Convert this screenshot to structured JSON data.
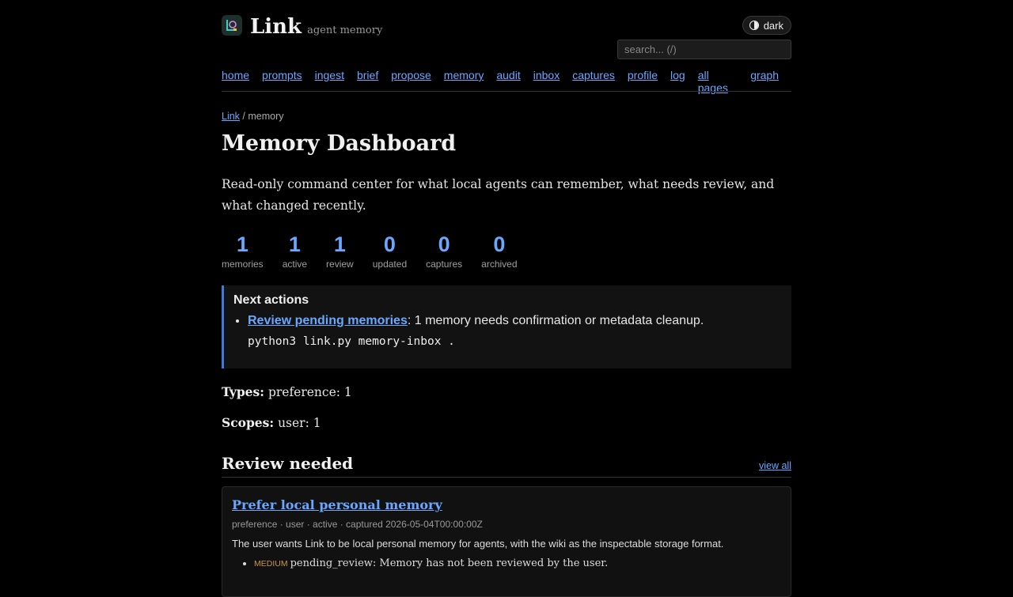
{
  "brand": {
    "name": "Link",
    "subtitle": "agent memory",
    "logo_icon": "link-logo-icon"
  },
  "theme_toggle": {
    "label": "dark",
    "icon": "half-circle-icon"
  },
  "search": {
    "placeholder": "search... (/)"
  },
  "nav": [
    "home",
    "prompts",
    "ingest",
    "brief",
    "propose",
    "memory",
    "audit",
    "inbox",
    "captures",
    "profile",
    "log",
    "all pages",
    "graph"
  ],
  "breadcrumb": {
    "root": "Link",
    "separator": "/",
    "current": "memory"
  },
  "page": {
    "title": "Memory Dashboard",
    "intro": "Read-only command center for what local agents can remember, what needs review, and what changed recently."
  },
  "stats": [
    {
      "value": "1",
      "label": "memories"
    },
    {
      "value": "1",
      "label": "active"
    },
    {
      "value": "1",
      "label": "review"
    },
    {
      "value": "0",
      "label": "updated"
    },
    {
      "value": "0",
      "label": "captures"
    },
    {
      "value": "0",
      "label": "archived"
    }
  ],
  "next_actions": {
    "heading": "Next actions",
    "link": "Review pending memories",
    "text": ": 1 memory needs confirmation or metadata cleanup.",
    "command": "python3 link.py memory-inbox ."
  },
  "types": {
    "label": "Types:",
    "value": "preference: 1"
  },
  "scopes": {
    "label": "Scopes:",
    "value": "user: 1"
  },
  "review": {
    "heading": "Review needed",
    "view_all": "view all",
    "card": {
      "title": "Prefer local personal memory",
      "meta": "preference · user · active · captured 2026-05-04T00:00:00Z",
      "description": "The user wants Link to be local personal memory for agents, with the wiki as the inspectable storage format.",
      "issue_severity": "MEDIUM",
      "issue_text": "pending_review: Memory has not been reviewed by the user."
    }
  },
  "colors": {
    "accent": "#6aa8ff",
    "callout_border": "#3d7cd9",
    "severity": "#c8954d",
    "background": "#000000"
  }
}
